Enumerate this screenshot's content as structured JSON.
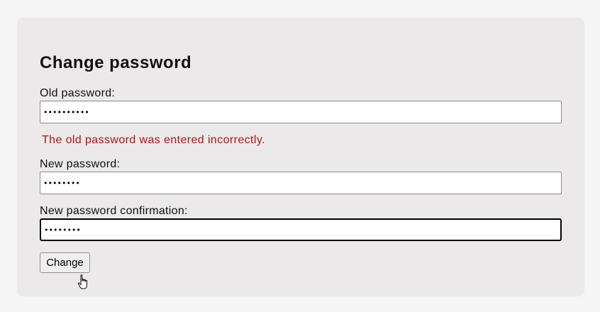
{
  "form": {
    "title": "Change password",
    "old_password": {
      "label": "Old password:",
      "value_mask": "••••••••••"
    },
    "error_message": "The old password was entered incorrectly.",
    "new_password": {
      "label": "New password:",
      "value_mask": "••••••••"
    },
    "new_password_confirmation": {
      "label": "New password confirmation:",
      "value_mask": "••••••••"
    },
    "submit_label": "Change"
  },
  "colors": {
    "background": "#f5f5f5",
    "card": "#ebe9ea",
    "error": "#b31313"
  },
  "cursor": "hand-pointer-icon"
}
